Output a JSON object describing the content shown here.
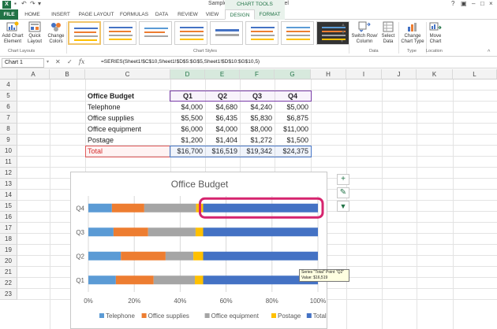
{
  "titlebar": {
    "document_title": "Sample Chart - DMS.xlsx - Excel",
    "chart_tools_label": "CHART TOOLS"
  },
  "tabs": [
    "FILE",
    "HOME",
    "INSERT",
    "PAGE LAYOUT",
    "FORMULAS",
    "DATA",
    "REVIEW",
    "VIEW",
    "DESIGN",
    "FORMAT"
  ],
  "ribbon": {
    "add_chart_element": "Add Chart Element",
    "quick_layout": "Quick Layout",
    "change_colors": "Change Colors",
    "switch_row_column": "Switch Row/ Column",
    "select_data": "Select Data",
    "change_chart_type": "Change Chart Type",
    "move_chart": "Move Chart",
    "groups": {
      "chart_layouts": "Chart Layouts",
      "chart_styles": "Chart Styles",
      "data": "Data",
      "type": "Type",
      "location": "Location"
    }
  },
  "formula_bar": {
    "name_box": "Chart 1",
    "formula": "=SERIES(Sheet1!$C$10,Sheet1!$D$5:$G$5,Sheet1!$D$10:$G$10,5)"
  },
  "columns": [
    "A",
    "B",
    "C",
    "D",
    "E",
    "F",
    "G",
    "H",
    "I",
    "J",
    "K",
    "L"
  ],
  "rows": [
    "4",
    "5",
    "6",
    "7",
    "8",
    "9",
    "10",
    "11",
    "12",
    "13",
    "14",
    "15",
    "16",
    "17",
    "18",
    "19",
    "20",
    "21",
    "22",
    "23"
  ],
  "table": {
    "header": [
      "Office Budget",
      "Q1",
      "Q2",
      "Q3",
      "Q4"
    ],
    "rows": [
      [
        "Telephone",
        "$4,000",
        "$4,680",
        "$4,240",
        "$5,000"
      ],
      [
        "Office supplies",
        "$5,500",
        "$6,435",
        "$5,830",
        "$6,875"
      ],
      [
        "Office equipment",
        "$6,000",
        "$4,000",
        "$8,000",
        "$11,000"
      ],
      [
        "Postage",
        "$1,200",
        "$1,404",
        "$1,272",
        "$1,500"
      ],
      [
        "Total",
        "$16,700",
        "$16,519",
        "$19,342",
        "$24,375"
      ]
    ]
  },
  "tooltip": {
    "line1": "Series \"Total\" Point \"Q2\"",
    "line2": "Value: $16,519"
  },
  "chart_data": {
    "type": "bar",
    "stacked": "100%",
    "title": "Office Budget",
    "categories": [
      "Q1",
      "Q2",
      "Q3",
      "Q4"
    ],
    "series": [
      {
        "name": "Telephone",
        "color": "#5b9bd5",
        "values": [
          4000,
          4680,
          4240,
          5000
        ]
      },
      {
        "name": "Office supplies",
        "color": "#ed7d31",
        "values": [
          5500,
          6435,
          5830,
          6875
        ]
      },
      {
        "name": "Office equipment",
        "color": "#a5a5a5",
        "values": [
          6000,
          4000,
          8000,
          11000
        ]
      },
      {
        "name": "Postage",
        "color": "#ffc000",
        "values": [
          1200,
          1404,
          1272,
          1500
        ]
      },
      {
        "name": "Total",
        "color": "#4472c4",
        "values": [
          16700,
          16519,
          19342,
          24375
        ]
      }
    ],
    "x_ticks": [
      "0%",
      "20%",
      "40%",
      "60%",
      "80%",
      "100%"
    ],
    "legend_position": "bottom",
    "highlight_color": "#d6246e",
    "grid": true
  }
}
